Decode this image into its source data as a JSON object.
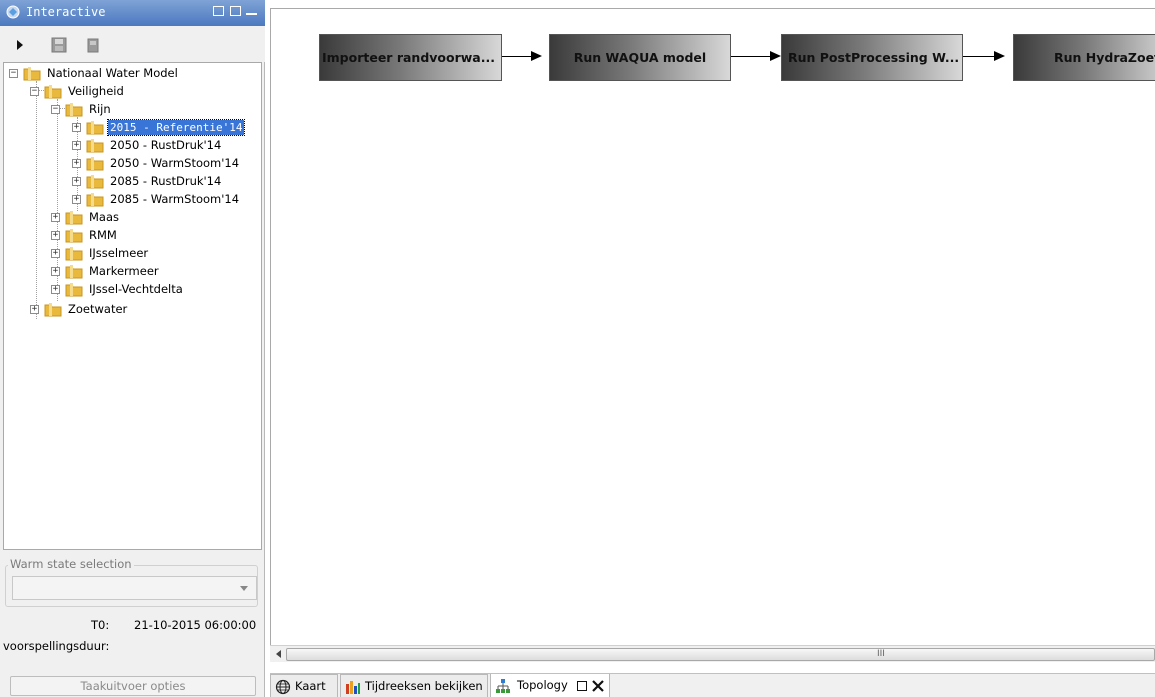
{
  "panel": {
    "title": "Interactive",
    "icon": "interactive-icon",
    "header_buttons": [
      "restore-icon",
      "maximize-icon",
      "minimize-icon"
    ]
  },
  "toolbar": {
    "buttons": [
      {
        "name": "run-icon"
      },
      {
        "name": "save-icon"
      },
      {
        "name": "delete-icon"
      }
    ]
  },
  "tree": {
    "root": "Nationaal Water Model",
    "veiligheid": "Veiligheid",
    "rijn": "Rijn",
    "rijn_items": [
      "2015 - Referentie'14",
      "2050 - RustDruk'14",
      "2050 - WarmStoom'14",
      "2085 - RustDruk'14",
      "2085 - WarmStoom'14"
    ],
    "selected_index": 0,
    "veiligheid_items": [
      "Maas",
      "RMM",
      "IJsselmeer",
      "Markermeer",
      "IJssel-Vechtdelta"
    ],
    "zoetwater": "Zoetwater"
  },
  "warm_state": {
    "legend": "Warm state selection",
    "selected": ""
  },
  "t0": {
    "label": "T0:",
    "value": "21-10-2015 06:00:00"
  },
  "duration_label": "voorspellingsduur:",
  "task_button": "Taakuitvoer opties",
  "topology": {
    "steps": [
      "Importeer randvoorwa...",
      "Run WAQUA model",
      "Run PostProcessing W...",
      "Run HydraZoet"
    ]
  },
  "scrollbar": {
    "grip": "III"
  },
  "tabs": [
    {
      "label": "Kaart",
      "icon": "globe-icon"
    },
    {
      "label": "Tijdreeksen bekijken",
      "icon": "chart-icon"
    },
    {
      "label": "Topology",
      "icon": "topology-icon"
    }
  ],
  "colors": {
    "header": "#4b78bf",
    "selection": "#3875d7",
    "folder": "#e8b93c"
  }
}
